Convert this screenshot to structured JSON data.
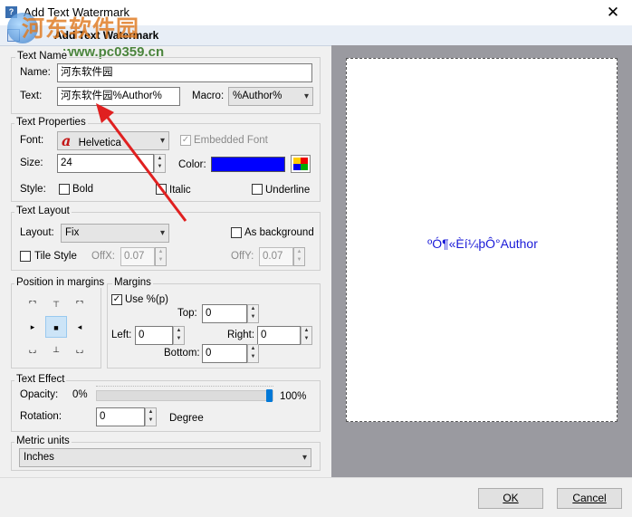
{
  "window": {
    "title": "Add Text Watermark",
    "close_glyph": "✕"
  },
  "header": {
    "title": "Add Text Watermark"
  },
  "watermark_overlay": {
    "site_name": "河东软件园",
    "url": "www.pc0359.cn"
  },
  "text_name": {
    "group_label": "Text Name",
    "name_label": "Name:",
    "name_value": "河东软件园",
    "text_label": "Text:",
    "text_value": "河东软件园%Author%",
    "macro_label": "Macro:",
    "macro_value": "%Author%"
  },
  "text_properties": {
    "group_label": "Text Properties",
    "font_label": "Font:",
    "font_glyph": "a",
    "font_value": "Helvetica",
    "embedded_font_label": "Embedded Font",
    "embedded_font_checked": true,
    "size_label": "Size:",
    "size_value": "24",
    "color_label": "Color:",
    "color_value": "#0000ff",
    "style_label": "Style:",
    "bold_label": "Bold",
    "italic_label": "Italic",
    "underline_label": "Underline"
  },
  "text_layout": {
    "group_label": "Text Layout",
    "layout_label": "Layout:",
    "layout_value": "Fix",
    "as_background_label": "As background",
    "tile_style_label": "Tile Style",
    "offx_label": "OffX:",
    "offx_value": "0.07",
    "offy_label": "OffY:",
    "offy_value": "0.07"
  },
  "position": {
    "group_label": "Position in margins",
    "selected": "center"
  },
  "margins": {
    "group_label": "Margins",
    "use_percent_label": "Use %(p)",
    "use_percent_checked": true,
    "top_label": "Top:",
    "top_value": "0",
    "left_label": "Left:",
    "left_value": "0",
    "right_label": "Right:",
    "right_value": "0",
    "bottom_label": "Bottom:",
    "bottom_value": "0"
  },
  "text_effect": {
    "group_label": "Text Effect",
    "opacity_label": "Opacity:",
    "opacity_min": "0%",
    "opacity_max": "100%",
    "opacity_level": 1.0,
    "rotation_label": "Rotation:",
    "rotation_value": "0",
    "rotation_unit": "Degree"
  },
  "metric_units": {
    "group_label": "Metric units",
    "value": "Inches"
  },
  "preview": {
    "text": "ºÓ¶«Èí¼þÔ°Author"
  },
  "buttons": {
    "ok": "OK",
    "cancel": "Cancel"
  }
}
